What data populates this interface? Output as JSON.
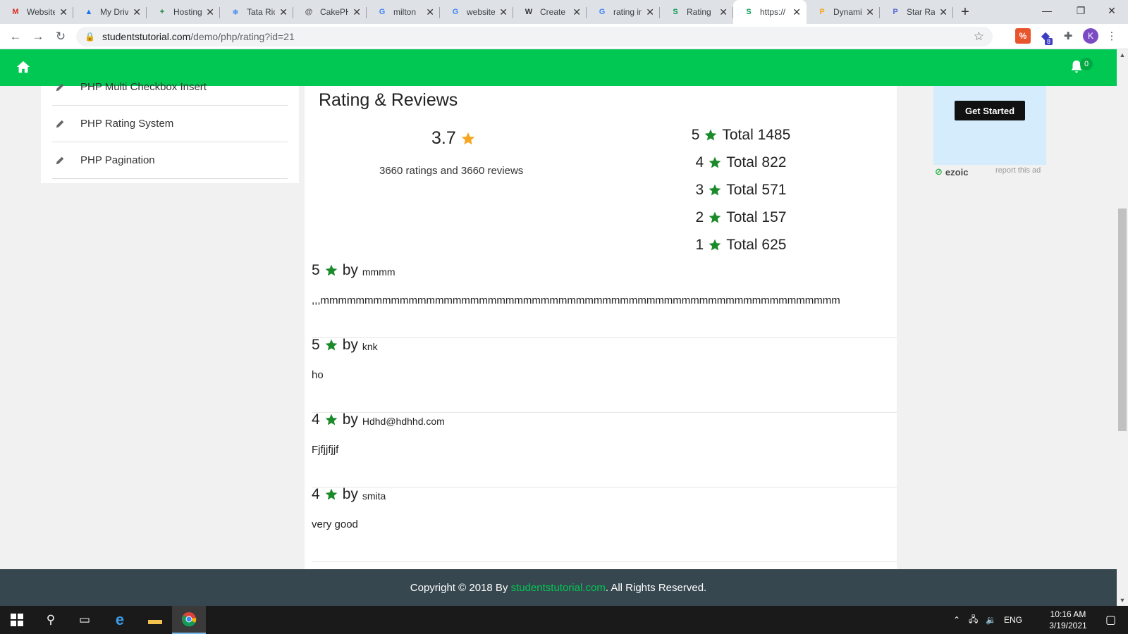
{
  "browser": {
    "tabs": [
      {
        "title": "Website",
        "favicon": "gmail-icon",
        "color": "#d93025",
        "glyph": "M"
      },
      {
        "title": "My Drive",
        "favicon": "drive-icon",
        "color": "#1a73e8",
        "glyph": "▲"
      },
      {
        "title": "Hosting",
        "favicon": "sheets-icon",
        "color": "#188038",
        "glyph": "+"
      },
      {
        "title": "Tata Rio",
        "favicon": "snowflake-icon",
        "color": "#1a73e8",
        "glyph": "❄"
      },
      {
        "title": "CakePHP",
        "favicon": "at-icon",
        "color": "#555555",
        "glyph": "@"
      },
      {
        "title": "milton",
        "favicon": "google-icon",
        "color": "#4285f4",
        "glyph": "G"
      },
      {
        "title": "website",
        "favicon": "google-icon",
        "color": "#4285f4",
        "glyph": "G"
      },
      {
        "title": "Create",
        "favicon": "w-icon",
        "color": "#333333",
        "glyph": "W"
      },
      {
        "title": "rating in",
        "favicon": "google-icon",
        "color": "#4285f4",
        "glyph": "G"
      },
      {
        "title": "Rating",
        "favicon": "s-icon",
        "color": "#0f9d58",
        "glyph": "S"
      },
      {
        "title": "https://",
        "favicon": "s-icon",
        "color": "#0f9d58",
        "glyph": "S",
        "active": true
      },
      {
        "title": "Dynamic",
        "favicon": "p-icon",
        "color": "#f5a623",
        "glyph": "P"
      },
      {
        "title": "Star Rat",
        "favicon": "pz-icon",
        "color": "#5b6bd6",
        "glyph": "P"
      }
    ],
    "new_tab_label": "+",
    "url_domain": "studentstutorial.com",
    "url_path": "/demo/php/rating?id=21",
    "profile_initial": "K",
    "extension_badge": "8"
  },
  "site": {
    "notification_count": "0",
    "sidebar_items": [
      {
        "label": "PHP Multi Checkbox Insert"
      },
      {
        "label": "PHP Rating System"
      },
      {
        "label": "PHP Pagination"
      }
    ],
    "section_title": "Rating & Reviews",
    "average_rating": "3.7",
    "ratings_summary": "3660 ratings and 3660 reviews",
    "breakdown": [
      {
        "stars": "5",
        "label": "Total 1485"
      },
      {
        "stars": "4",
        "label": "Total 822"
      },
      {
        "stars": "3",
        "label": "Total 571"
      },
      {
        "stars": "2",
        "label": "Total 157"
      },
      {
        "stars": "1",
        "label": "Total 625"
      }
    ],
    "by_label": "by",
    "reviews": [
      {
        "stars": "5",
        "user": "mmmm",
        "text": ",,,mmmmmmmmmmmmmmmmmmmmmmmmmmmmmmmmmmmmmmmmmmmmmmmmmmmmmmmmmmm"
      },
      {
        "stars": "5",
        "user": "knk",
        "text": "ho"
      },
      {
        "stars": "4",
        "user": "Hdhd@hdhhd.com",
        "text": "Fjfjjfjjf"
      },
      {
        "stars": "4",
        "user": "smita",
        "text": "very good"
      }
    ],
    "ad": {
      "button_label": "Get Started",
      "brand": "ezoic",
      "report_label": "report this ad"
    },
    "footer": {
      "prefix": "Copyright © 2018 By ",
      "brand": "studentstutorial.com",
      "suffix": ". All Rights Reserved."
    }
  },
  "taskbar": {
    "language": "ENG",
    "time": "10:16 AM",
    "date": "3/19/2021"
  },
  "colors": {
    "brand_green": "#00c853",
    "star_green": "#1b8a2a",
    "star_orange": "#f5a623",
    "footer_bg": "#37474f"
  }
}
